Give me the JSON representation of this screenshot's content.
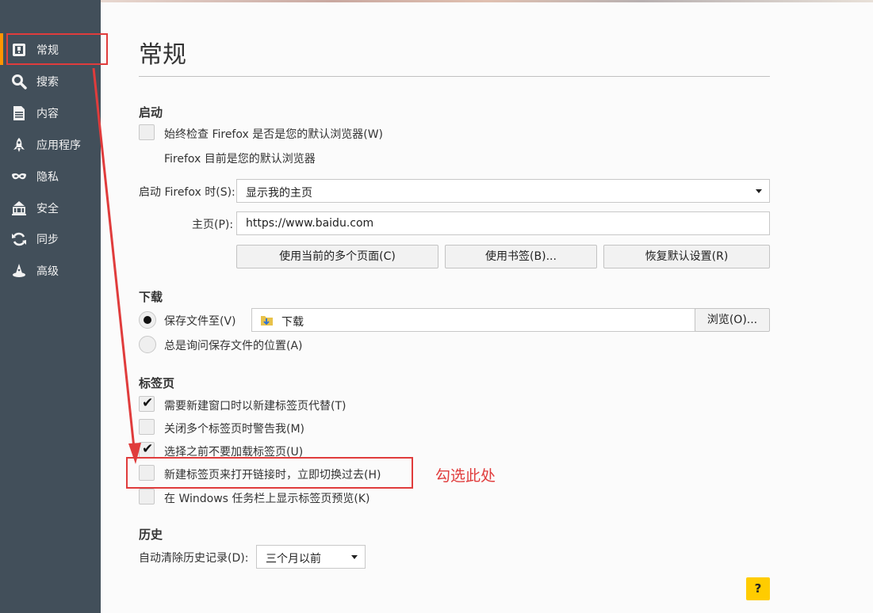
{
  "sidebar": {
    "items": [
      {
        "label": "常规",
        "icon": "general-icon"
      },
      {
        "label": "搜索",
        "icon": "search-icon"
      },
      {
        "label": "内容",
        "icon": "content-icon"
      },
      {
        "label": "应用程序",
        "icon": "applications-icon"
      },
      {
        "label": "隐私",
        "icon": "privacy-mask-icon"
      },
      {
        "label": "安全",
        "icon": "security-icon"
      },
      {
        "label": "同步",
        "icon": "sync-icon"
      },
      {
        "label": "高级",
        "icon": "advanced-icon"
      }
    ]
  },
  "page": {
    "title": "常规"
  },
  "startup": {
    "heading": "启动",
    "default_check_label": "始终检查 Firefox 是否是您的默认浏览器(W)",
    "default_status": "Firefox 目前是您的默认浏览器",
    "when_starts_label": "启动 Firefox 时(S):",
    "when_starts_value": "显示我的主页",
    "homepage_label": "主页(P):",
    "homepage_value": "https://www.baidu.com",
    "use_current_pages": "使用当前的多个页面(C)",
    "use_bookmark": "使用书签(B)...",
    "restore_default": "恢复默认设置(R)"
  },
  "downloads": {
    "heading": "下载",
    "save_to_label": "保存文件至(V)",
    "folder_name": "下载",
    "browse_button": "浏览(O)...",
    "always_ask_label": "总是询问保存文件的位置(A)"
  },
  "tabs": {
    "heading": "标签页",
    "options": [
      {
        "label": "需要新建窗口时以新建标签页代替(T)",
        "checked": true
      },
      {
        "label": "关闭多个标签页时警告我(M)",
        "checked": false
      },
      {
        "label": "选择之前不要加载标签页(U)",
        "checked": true
      },
      {
        "label": "新建标签页来打开链接时，立即切换过去(H)",
        "checked": false
      },
      {
        "label": "在 Windows 任务栏上显示标签页预览(K)",
        "checked": false
      }
    ]
  },
  "history": {
    "heading": "历史",
    "clear_label": "自动清除历史记录(D):",
    "clear_value": "三个月以前"
  },
  "annotation": {
    "text": "勾选此处",
    "color": "#e03c3c"
  },
  "help": {
    "label": "?"
  }
}
